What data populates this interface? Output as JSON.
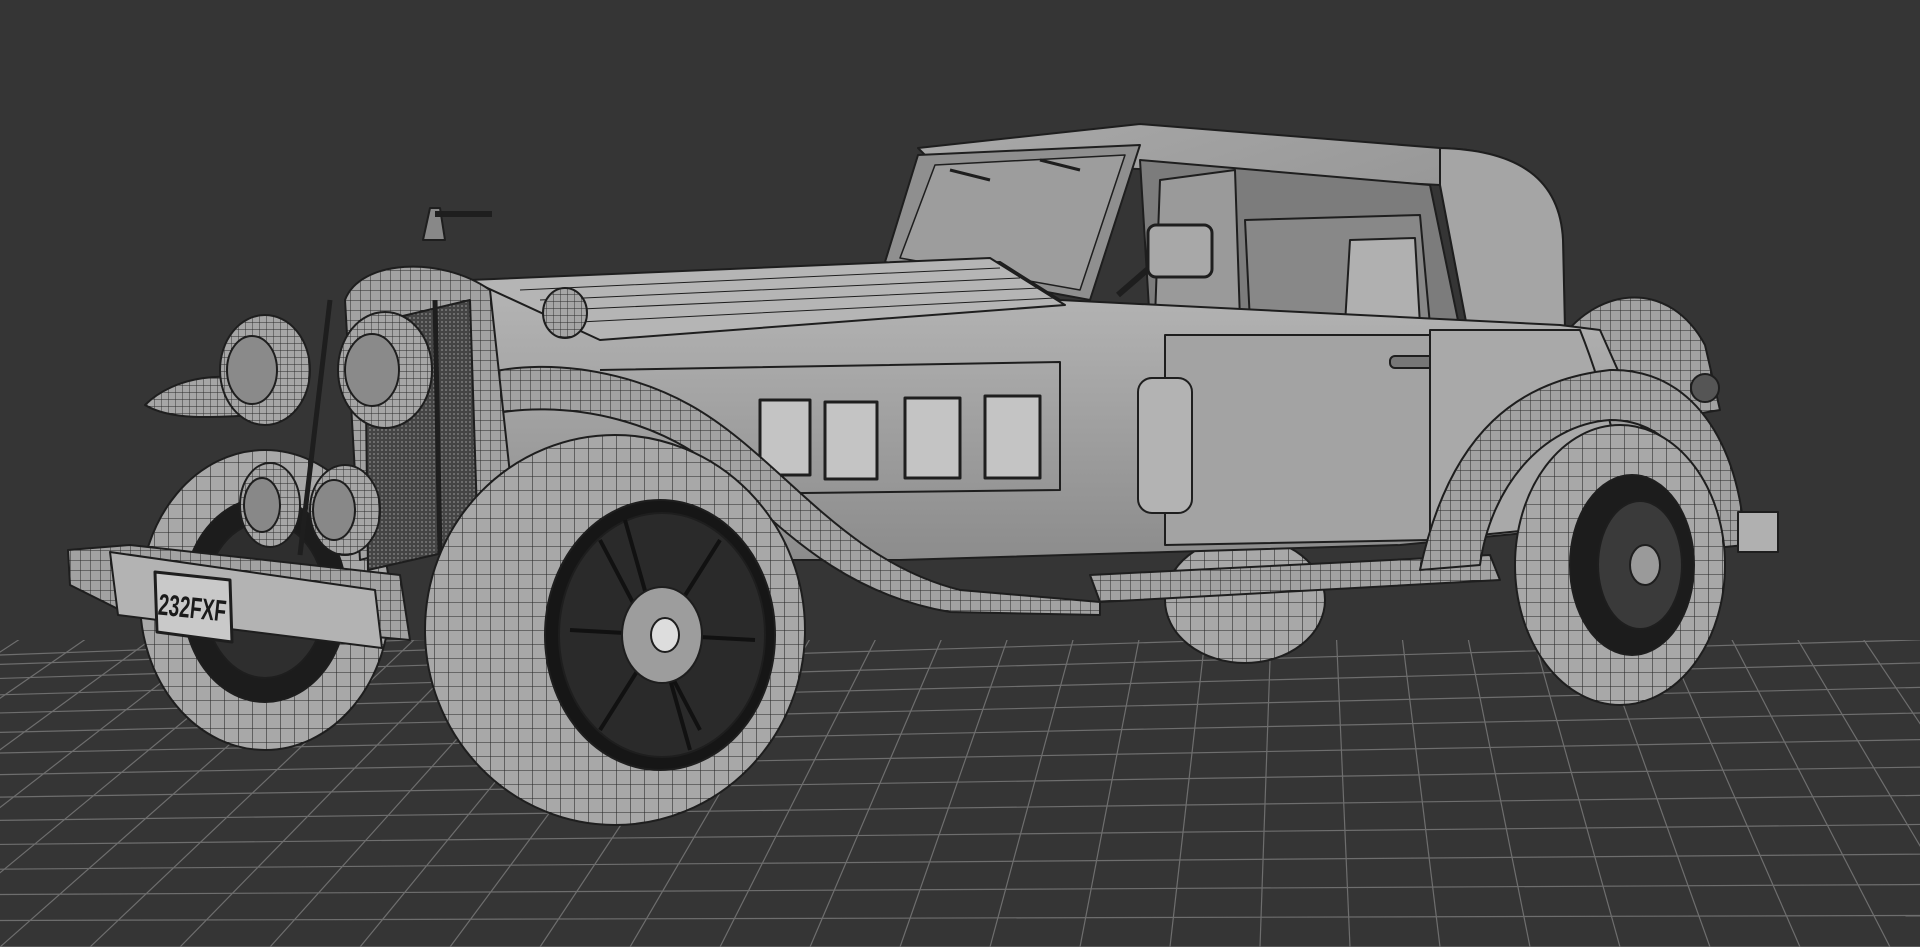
{
  "viewport": {
    "background_color": "#353535",
    "grid_color": "#6e6e6e",
    "model_fill_color": "#9a9a9a",
    "wire_color": "#1e1e1e",
    "render_mode": "shaded-with-wireframe"
  },
  "model": {
    "license_plate_text": "232FXF",
    "icon": "vintage-car-3d-model"
  }
}
